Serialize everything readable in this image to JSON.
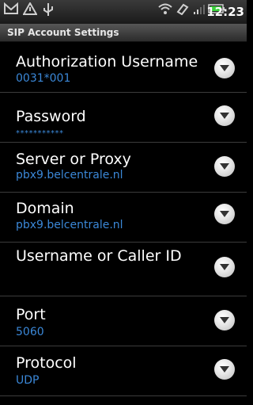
{
  "statusbar": {
    "icons": [
      "gmail-icon",
      "warning-icon",
      "usb-icon",
      "wifi-icon",
      "sync-icon",
      "signal-icon",
      "battery-icon"
    ],
    "time": "12:23"
  },
  "header": {
    "title": "SIP Account Settings"
  },
  "settings": [
    {
      "title": "Authorization Username",
      "value": "0031*001"
    },
    {
      "title": "Password",
      "value": "***********"
    },
    {
      "title": "Server or Proxy",
      "value": "pbx9.belcentrale.nl"
    },
    {
      "title": "Domain",
      "value": "pbx9.belcentrale.nl"
    },
    {
      "title": "Username or Caller ID",
      "value": ""
    },
    {
      "title": "Port",
      "value": "5060"
    },
    {
      "title": "Protocol",
      "value": "UDP"
    }
  ],
  "colors": {
    "value_text": "#3b88d8",
    "background": "#000000"
  }
}
